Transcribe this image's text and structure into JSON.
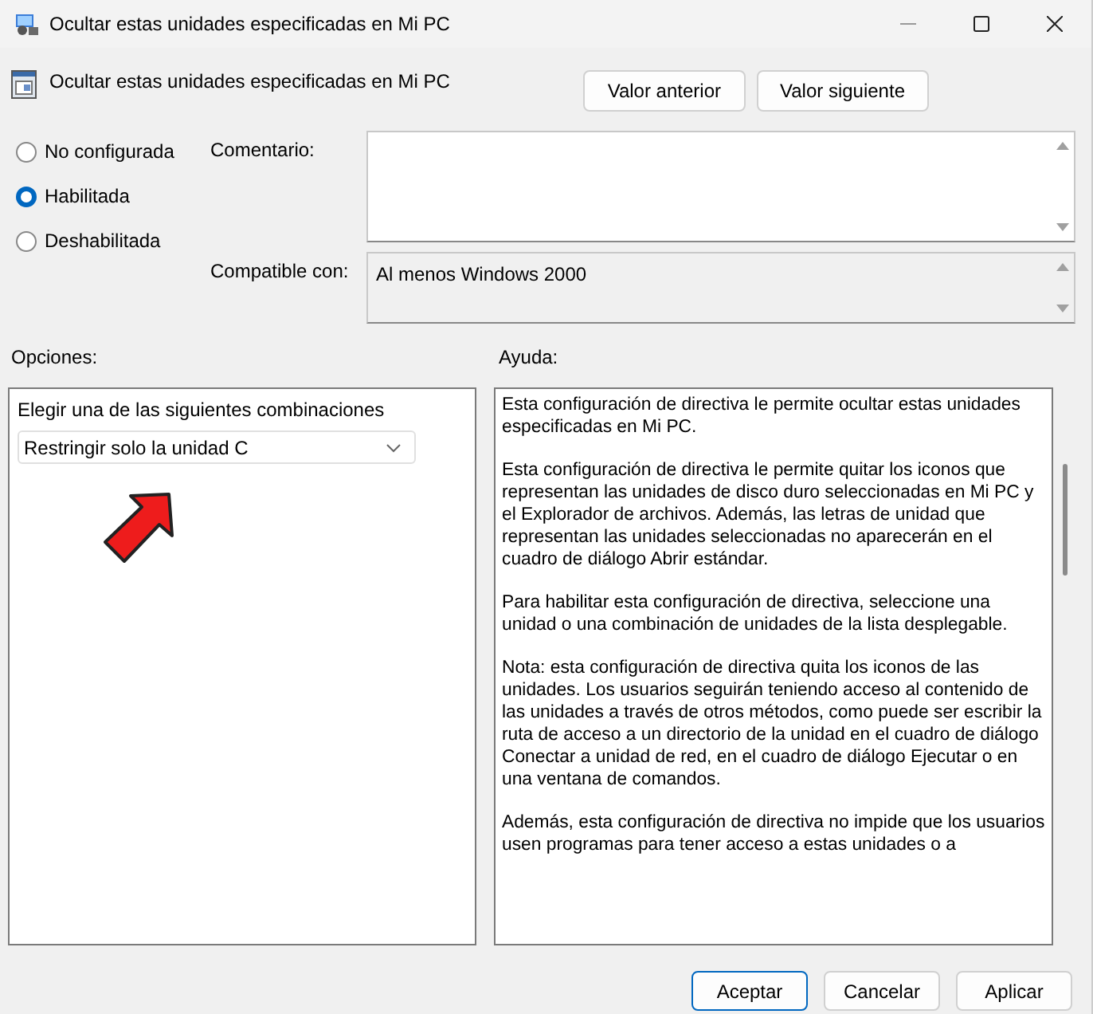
{
  "window": {
    "title": "Ocultar estas unidades especificadas en Mi PC"
  },
  "policy": {
    "name": "Ocultar estas unidades especificadas en Mi PC",
    "buttons": [
      {
        "label": "Valor anterior"
      },
      {
        "label": "Valor siguiente"
      }
    ]
  },
  "state_options": [
    {
      "label": "No configurada",
      "selected": false
    },
    {
      "label": "Habilitada",
      "selected": true
    },
    {
      "label": "Deshabilitada",
      "selected": false
    }
  ],
  "comment": {
    "label": "Comentario:"
  },
  "compatible": {
    "label": "Compatible con:",
    "value": "Al menos Windows 2000"
  },
  "options": {
    "label": "Opciones:",
    "prompt": "Elegir una de las siguientes combinaciones",
    "dropdown": {
      "value": "Restringir solo la unidad C"
    }
  },
  "help": {
    "label": "Ayuda:",
    "paragraphs": [
      "Esta configuración de directiva le permite ocultar estas unidades especificadas en Mi PC.",
      "Esta configuración de directiva le permite quitar los iconos que representan las unidades de disco duro seleccionadas en Mi PC y el Explorador de archivos. Además, las letras de unidad que representan las unidades seleccionadas no aparecerán en el cuadro de diálogo Abrir estándar.",
      "Para habilitar esta configuración de directiva, seleccione una unidad o una combinación de unidades de la lista desplegable.",
      "Nota: esta configuración de directiva quita los iconos de las unidades. Los usuarios seguirán teniendo acceso al contenido de las unidades a través de otros métodos, como puede ser escribir la ruta de acceso a un directorio de la unidad en el cuadro de diálogo Conectar a unidad de red, en el cuadro de diálogo Ejecutar o en una ventana de comandos.",
      "Además, esta configuración de directiva no impide que los usuarios usen programas para tener acceso a estas unidades o a"
    ]
  },
  "footer_buttons": [
    {
      "label": "Aceptar",
      "default": true
    },
    {
      "label": "Cancelar",
      "default": false
    },
    {
      "label": "Aplicar",
      "default": false
    }
  ]
}
